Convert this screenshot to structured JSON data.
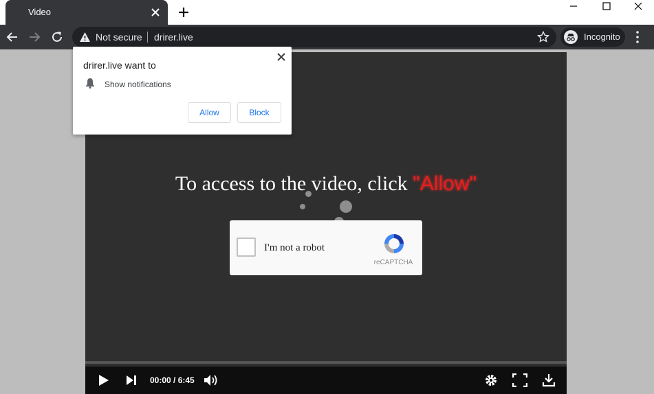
{
  "browser": {
    "tab_title": "Video",
    "security_label": "Not secure",
    "url": "drirer.live",
    "incognito_label": "Incognito"
  },
  "popup": {
    "title": "drirer.live want to",
    "permission": "Show notifications",
    "allow_label": "Allow",
    "block_label": "Block"
  },
  "page": {
    "headline_prefix": "To access to the video, click ",
    "headline_highlight": "\"Allow\""
  },
  "captcha": {
    "label": "I'm not a robot",
    "brand": "reCAPTCHA"
  },
  "player": {
    "time": "00:00 / 6:45",
    "progress": 0
  },
  "colors": {
    "highlight": "#e61e1e",
    "toolbar": "#35363a",
    "popup_button_text": "#1a73e8"
  }
}
